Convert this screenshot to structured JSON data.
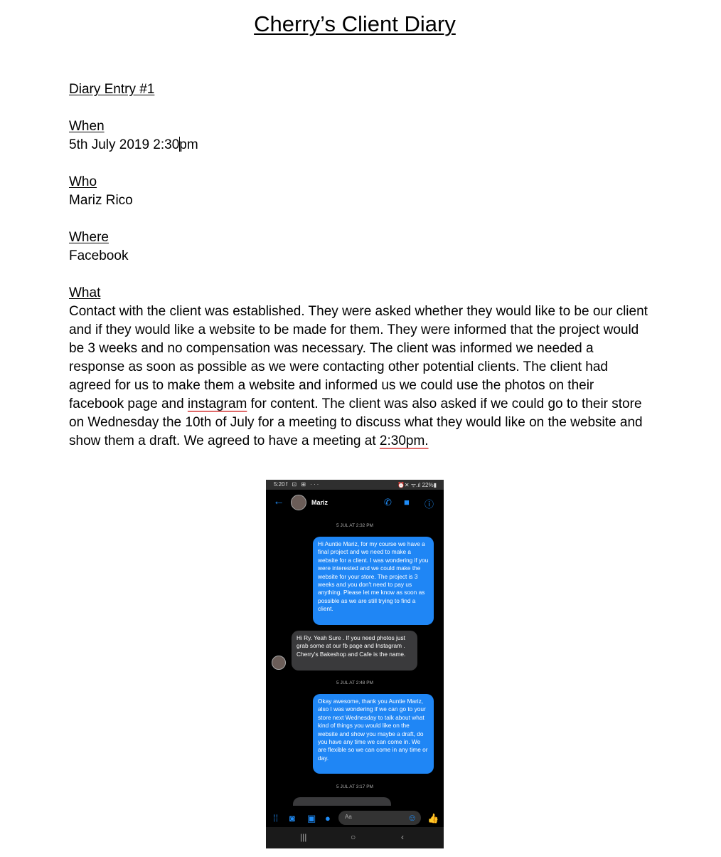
{
  "document": {
    "title": "Cherry’s Client Diary",
    "entry_heading": "Diary Entry #1",
    "when_label": "When",
    "when_value_a": "5th July 2019 2:30",
    "when_value_b": "pm",
    "who_label": "Who",
    "who_value": "Mariz Rico",
    "where_label": "Where",
    "where_value": "Facebook",
    "what_label": "What",
    "what_part1": "Contact with the client was established. They were asked whether they would like to be our client and if they would like a website to be made for them. They were informed that the project would be 3 weeks and no compensation was necessary. The client was informed we needed a response as soon as possible as we were contacting other potential clients. The client had agreed for us to make them a website and informed us we could use the photos on their facebook page and ",
    "what_spell1": "instagram",
    "what_part2": " for content. The client was also asked if we could go to their store on Wednesday the 10th of July for a meeting to discuss what they would like on the website and show them a draft. We agreed to have a meeting at ",
    "what_spell2": "2:30pm."
  },
  "phone": {
    "status_time": "5:20",
    "status_icons": "f ⊡ ⊞ ···",
    "status_battery": "⏰✕ ᯤ.ıl 22%▮",
    "contact_name": "Mariz",
    "timestamp1": "5 JUL AT 2:32 PM",
    "msg1": "Hi Auntie Mariz, for my course we have a final project and we need to make a website for a client. I was wondering if you were interested and we could make the website for your store. The project is 3 weeks and you don't need to pay us anything. Please let me know as soon as possible as we are still trying to find a client.",
    "msg2": "Hi Ry.  Yeah Sure .  If you need photos just grab some  at our fb page and Instagram .  Cherry's Bakeshop and Cafe is the name.",
    "timestamp2": "5 JUL AT 2:48 PM",
    "msg3": "Okay awesome, thank you Auntie Mariz, also I was wondering if we can go to your store next Wednesday to talk about what kind of things you would like on the website and show you maybe a draft, do you have any time we can come in. We are flexible so we can come in any time or day.",
    "timestamp3": "5 JUL AT 3:17 PM",
    "composer_placeholder": "Aa"
  }
}
